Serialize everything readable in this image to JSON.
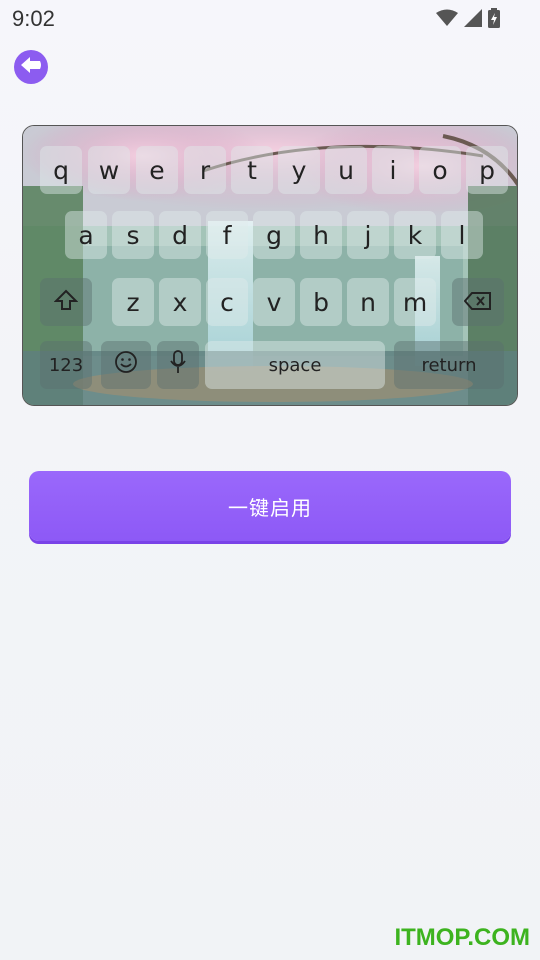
{
  "status_bar": {
    "time": "9:02",
    "icons": [
      "wifi-icon",
      "signal-icon",
      "battery-icon"
    ]
  },
  "back_button": {
    "icon": "back-arrow-icon",
    "color": "#8c5cf0"
  },
  "keyboard_preview": {
    "rows": [
      [
        "q",
        "w",
        "e",
        "r",
        "t",
        "y",
        "u",
        "i",
        "o",
        "p"
      ],
      [
        "a",
        "s",
        "d",
        "f",
        "g",
        "h",
        "j",
        "k",
        "l"
      ],
      [
        "z",
        "x",
        "c",
        "v",
        "b",
        "n",
        "m"
      ]
    ],
    "shift_icon": "shift-icon",
    "delete_icon": "backspace-icon",
    "bottom_row": {
      "numbers_label": "123",
      "emoji_icon": "emoji-icon",
      "mic_icon": "microphone-icon",
      "space_label": "space",
      "return_label": "return"
    }
  },
  "enable_button": {
    "label": "一键启用",
    "color": "#9161f7"
  },
  "watermark": {
    "text": "ITMOP.COM",
    "color": "#3db31f"
  }
}
